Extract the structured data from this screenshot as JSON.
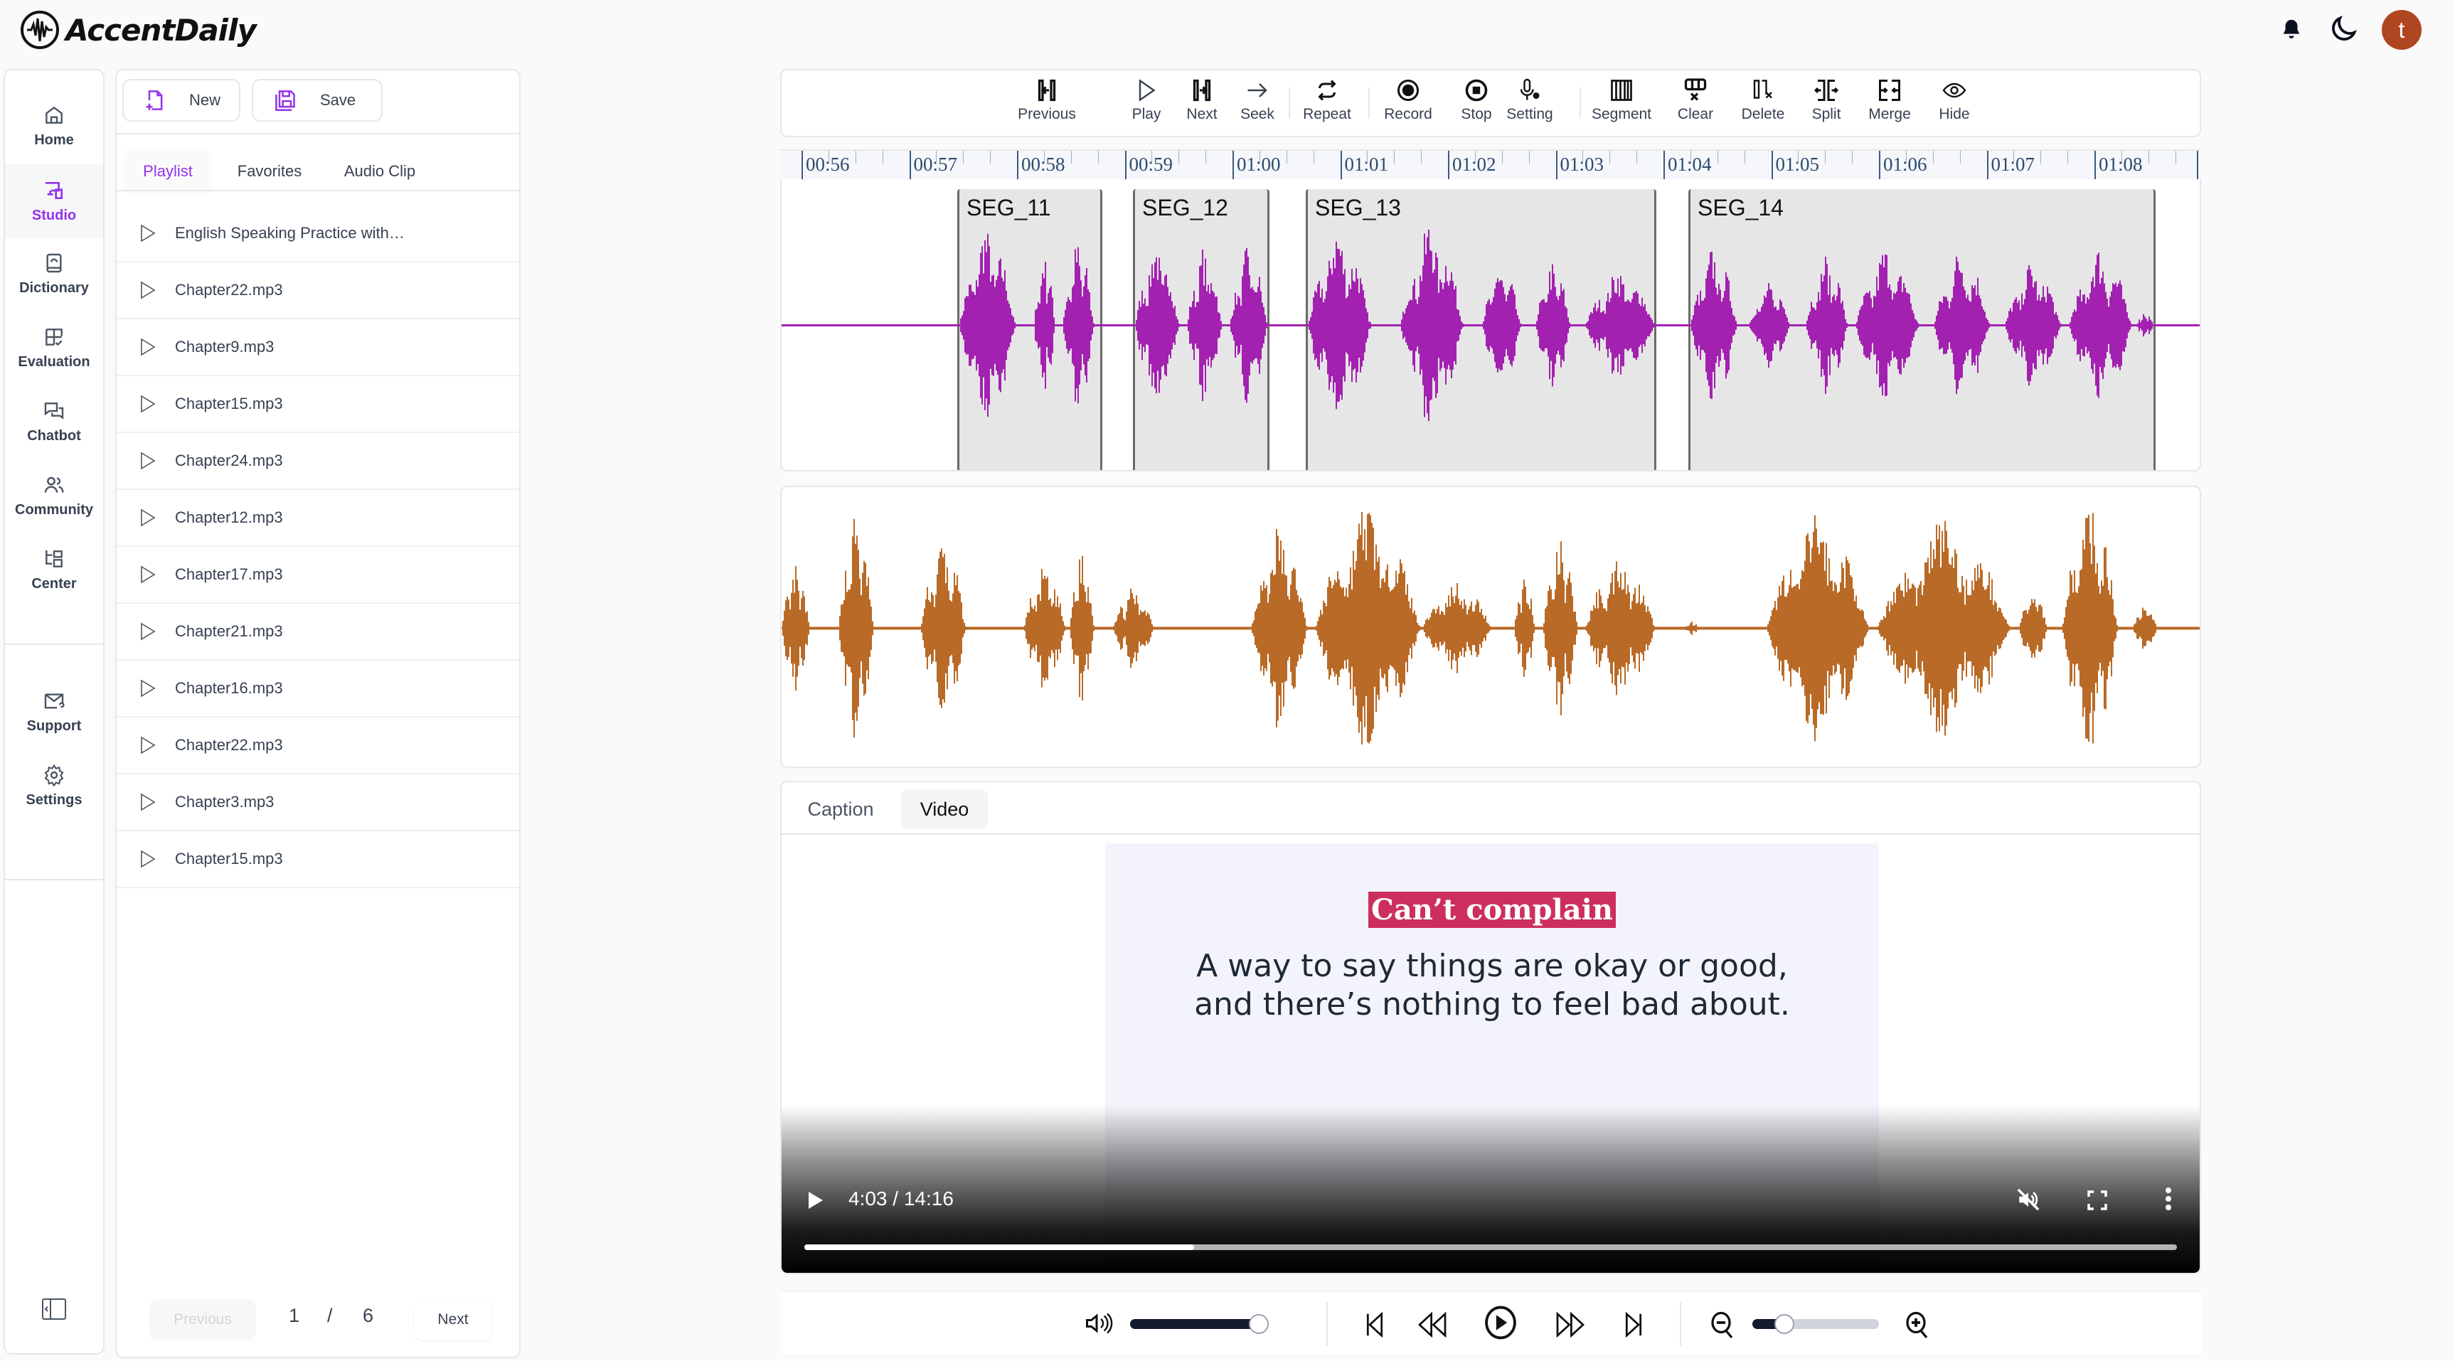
{
  "app": {
    "name": "AccentDaily",
    "avatar_initial": "t",
    "accent_color": "#9333ea",
    "avatar_color": "#b04522"
  },
  "sidebar": {
    "items": [
      {
        "label": "Home",
        "icon": "home-icon",
        "active": false
      },
      {
        "label": "Studio",
        "icon": "studio-icon",
        "active": true
      },
      {
        "label": "Dictionary",
        "icon": "dictionary-icon",
        "active": false
      },
      {
        "label": "Evaluation",
        "icon": "evaluation-icon",
        "active": false
      },
      {
        "label": "Chatbot",
        "icon": "chatbot-icon",
        "active": false
      },
      {
        "label": "Community",
        "icon": "community-icon",
        "active": false
      },
      {
        "label": "Center",
        "icon": "center-icon",
        "active": false
      }
    ],
    "bottom_items": [
      {
        "label": "Support",
        "icon": "support-icon"
      },
      {
        "label": "Settings",
        "icon": "settings-icon"
      }
    ]
  },
  "playlist_panel": {
    "new_label": "New",
    "save_label": "Save",
    "tabs": [
      {
        "label": "Playlist",
        "active": true
      },
      {
        "label": "Favorites",
        "active": false
      },
      {
        "label": "Audio Clip",
        "active": false
      }
    ],
    "items": [
      "English Speaking Practice with…",
      "Chapter22.mp3",
      "Chapter9.mp3",
      "Chapter15.mp3",
      "Chapter24.mp3",
      "Chapter12.mp3",
      "Chapter17.mp3",
      "Chapter21.mp3",
      "Chapter16.mp3",
      "Chapter22.mp3",
      "Chapter3.mp3",
      "Chapter15.mp3"
    ],
    "pagination": {
      "previous_label": "Previous",
      "current_page": "1",
      "separator": "/",
      "total_pages": "6",
      "next_label": "Next"
    }
  },
  "toolbar": {
    "groups": [
      [
        {
          "label": "Previous",
          "icon": "previous-segment-icon"
        },
        {
          "label": "Play",
          "icon": "play-icon"
        },
        {
          "label": "Next",
          "icon": "next-segment-icon"
        },
        {
          "label": "Seek",
          "icon": "seek-arrow-icon"
        }
      ],
      [
        {
          "label": "Repeat",
          "icon": "repeat-icon"
        }
      ],
      [
        {
          "label": "Record",
          "icon": "record-icon"
        },
        {
          "label": "Stop",
          "icon": "stop-icon"
        },
        {
          "label": "Setting",
          "icon": "mic-setting-icon"
        }
      ],
      [
        {
          "label": "Segment",
          "icon": "segment-icon"
        },
        {
          "label": "Clear",
          "icon": "clear-segments-icon"
        },
        {
          "label": "Delete",
          "icon": "delete-segment-icon"
        },
        {
          "label": "Split",
          "icon": "split-icon"
        },
        {
          "label": "Merge",
          "icon": "merge-icon"
        },
        {
          "label": "Hide",
          "icon": "eye-icon"
        }
      ]
    ]
  },
  "timeline": {
    "ticks": [
      "00:56",
      "00:57",
      "00:58",
      "00:59",
      "01:00",
      "01:01",
      "01:02",
      "01:03",
      "01:04",
      "01:05",
      "01:06",
      "01:07",
      "01:08"
    ],
    "segment_waveform_color": "#a321b0",
    "reference_waveform_color": "#b96a27",
    "segments": [
      {
        "label": "SEG_11"
      },
      {
        "label": "SEG_12"
      },
      {
        "label": "SEG_13"
      },
      {
        "label": "SEG_14"
      }
    ]
  },
  "media": {
    "tabs": [
      {
        "label": "Caption",
        "active": false
      },
      {
        "label": "Video",
        "active": true
      }
    ],
    "video": {
      "title": "Can’t complain",
      "description_line1": "A way to say things are okay or good,",
      "description_line2": "and there’s nothing to feel bad about.",
      "current_time": "4:03",
      "duration": "14:16",
      "time_display": "4:03 / 14:16",
      "progress_fraction": 0.284,
      "muted": true,
      "title_highlight_color": "#cc2f5e"
    }
  },
  "player_controls": {
    "volume_fraction": 0.95,
    "zoom_fraction": 0.25
  }
}
